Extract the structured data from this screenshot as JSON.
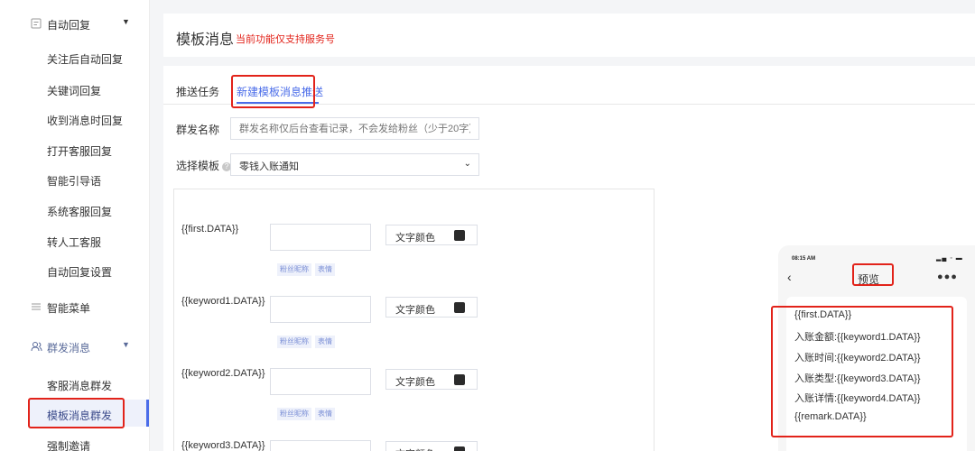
{
  "sidebar": {
    "groups": [
      {
        "label": "自动回复",
        "icon": "chat-icon",
        "items": [
          "关注后自动回复",
          "关键词回复",
          "收到消息时回复",
          "打开客服回复",
          "智能引导语",
          "系统客服回复",
          "转人工客服",
          "自动回复设置"
        ]
      },
      {
        "label": "智能菜单",
        "icon": "menu-icon"
      },
      {
        "label": "群发消息",
        "icon": "users-icon",
        "items": [
          "客服消息群发",
          "模板消息群发",
          "强制邀请"
        ]
      }
    ],
    "active_item": "模板消息群发"
  },
  "header": {
    "title": "模板消息",
    "note": "当前功能仅支持服务号"
  },
  "tabs": [
    "推送任务",
    "新建模板消息推送"
  ],
  "form": {
    "name_label": "群发名称",
    "name_placeholder": "群发名称仅后台查看记录，不会发给粉丝（少于20字）",
    "template_label": "选择模板",
    "template_value": "零钱入账通知"
  },
  "fields": [
    {
      "key": "{{first.DATA}}"
    },
    {
      "key": "{{keyword1.DATA}}"
    },
    {
      "key": "{{keyword2.DATA}}"
    },
    {
      "key": "{{keyword3.DATA}}"
    }
  ],
  "field_color_label": "文字颜色",
  "field_tags": [
    "粉丝昵称",
    "表情"
  ],
  "colors": {
    "accent": "#4a6ce9",
    "highlight": "#e2231a",
    "swatch": "#2b2b2b"
  },
  "preview": {
    "time": "08:15 AM",
    "title": "预览",
    "lines": [
      "{{first.DATA}}",
      "入账金额:{{keyword1.DATA}}",
      "入账时间:{{keyword2.DATA}}",
      "入账类型:{{keyword3.DATA}}",
      "入账详情:{{keyword4.DATA}}",
      "{{remark.DATA}}"
    ]
  }
}
